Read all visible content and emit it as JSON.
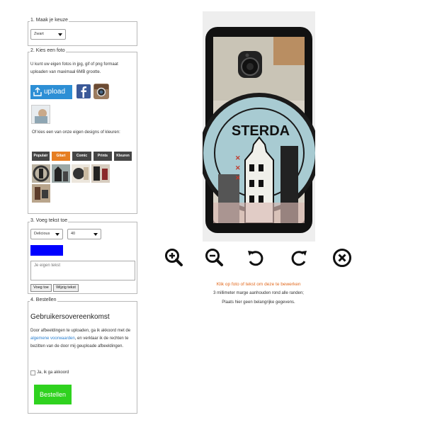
{
  "step1": {
    "legend": "1. Maak je keuze",
    "color_select": "Zwart"
  },
  "step2": {
    "legend": "2. Kies een foto",
    "instructions": "U kunt uw eigen fotos in jpg, gif of png formaat uploaden van maximaal 6MB grootte.",
    "upload_label": "upload",
    "designs_text": "Of kies een van onze eigen designs of kleuren:",
    "tabs": [
      "Populair",
      "Gitari",
      "Comic",
      "Prints",
      "Kleuren"
    ]
  },
  "step3": {
    "legend": "3. Voeg tekst toe",
    "font_select": "Delicious",
    "size_select": "40",
    "text_color": "#0000ff",
    "text_placeholder": "Je eigen tekst",
    "add_button": "Voeg toe",
    "edit_button": "Wijzig tekst"
  },
  "step4": {
    "legend": "4. Bestellen",
    "agreement_title": "Gebruikersovereenkomst",
    "agreement_part1": "Door afbeeldingen te uploaden, ga ik akkoord met de ",
    "agreement_link": "algemene voorwaarden",
    "agreement_part2": ", en verklaar ik de rechten te bezitten van de door mij geuploade afbeeldingen.",
    "checkbox_label": "Ja, ik ga akkoord",
    "order_button": "Bestellen",
    "order_color": "#2fd21f"
  },
  "preview": {
    "stamp_text": "STERDA",
    "edit_hint": "Klik op foto of tekst om deze te bewerken",
    "margin_note": "3 millimeter marge aanhouden rond alle randen;",
    "data_note": "Plaats hier geen belangrijke gegevens.",
    "hint_color": "#e2691e",
    "tools": [
      "zoom-in-icon",
      "zoom-out-icon",
      "rotate-left-icon",
      "rotate-right-icon",
      "delete-icon"
    ]
  }
}
